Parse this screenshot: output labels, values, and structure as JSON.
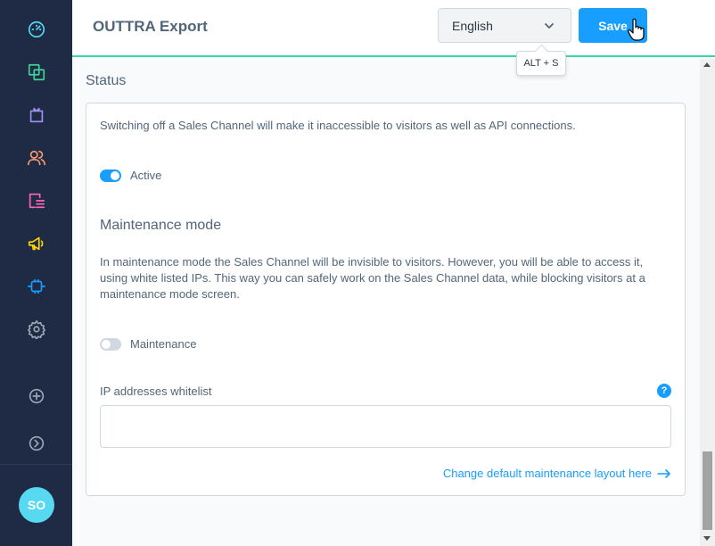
{
  "header": {
    "title": "OUTTRA Export",
    "language": "English",
    "save_label": "Save",
    "save_shortcut": "ALT + S"
  },
  "sidebar": {
    "items": [
      {
        "name": "dashboard",
        "icon": "gauge-icon",
        "color": "#57d9f2"
      },
      {
        "name": "catalogues",
        "icon": "catalogue-icon",
        "color": "#40d499"
      },
      {
        "name": "orders",
        "icon": "shopping-bag-icon",
        "color": "#a092f0"
      },
      {
        "name": "customers",
        "icon": "users-icon",
        "color": "#fb9d73"
      },
      {
        "name": "content",
        "icon": "content-icon",
        "color": "#ff68b4"
      },
      {
        "name": "marketing",
        "icon": "megaphone-icon",
        "color": "#ffd700"
      },
      {
        "name": "extensions",
        "icon": "plug-icon",
        "color": "#189eff"
      },
      {
        "name": "settings",
        "icon": "gear-icon",
        "color": "#9aa8b5"
      },
      {
        "name": "add-sales-channel",
        "icon": "plus-circle-icon",
        "color": "#9aa8b5"
      },
      {
        "name": "expand",
        "icon": "chevron-right-circle-icon",
        "color": "#9aa8b5"
      }
    ],
    "avatar_initials": "SO",
    "avatar_color": "#57d9f2"
  },
  "status": {
    "title": "Status",
    "description": "Switching off a Sales Channel will make it inaccessible to visitors as well as API connections.",
    "active_label": "Active",
    "active": true
  },
  "maintenance": {
    "title": "Maintenance mode",
    "description": "In maintenance mode the Sales Channel will be invisible to visitors. However, you will be able to access it, using white listed IPs. This way you can safely work on the Sales Channel data, while blocking visitors at a maintenance mode screen.",
    "toggle_label": "Maintenance",
    "enabled": false,
    "ip_label": "IP addresses whitelist",
    "ip_value": "",
    "help_glyph": "?",
    "layout_link": "Change default maintenance layout here"
  },
  "colors": {
    "accent": "#189eff",
    "header_border": "#37d8a8",
    "sidebar_bg": "#1f2a44"
  }
}
